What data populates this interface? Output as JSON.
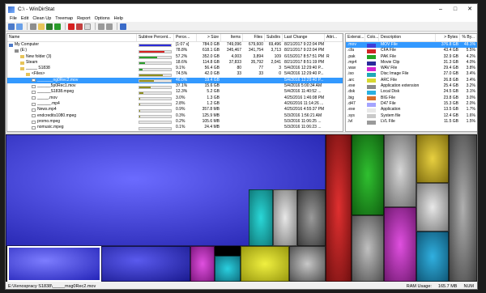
{
  "window": {
    "title": "C:\\ - WinDirStat"
  },
  "menu": [
    "File",
    "Edit",
    "Clean Up",
    "Treemap",
    "Report",
    "Options",
    "Help"
  ],
  "tree": {
    "headers": [
      "Name",
      "Subtree Percent...",
      "Perce...",
      "> Size",
      "Items",
      "Files",
      "Subdirs",
      "Last Change",
      "Attri..."
    ],
    "rows": [
      {
        "indent": 0,
        "icon": "computer-icon",
        "name": "My Computer",
        "pct": 1.0,
        "pcolor": "#2b2bd8",
        "perc": "[1:07 s]",
        "size": "784.0 GB",
        "items": "749,096",
        "files": "679,600",
        "subdirs": "69,496",
        "last": "8/21/2017  9:22:04 PM",
        "attr": ""
      },
      {
        "indent": 1,
        "icon": "drive-icon",
        "name": "(E:)",
        "pct": 0.788,
        "pcolor": "#d62020",
        "perc": "78.8%",
        "size": "618.1 GB",
        "items": "345,467",
        "files": "341,754",
        "subdirs": "3,713",
        "last": "8/21/2017  9:22:04 PM",
        "attr": ""
      },
      {
        "indent": 2,
        "icon": "folder-icon",
        "name": "New folder (3)",
        "pct": 0.572,
        "pcolor": "#2a9d2a",
        "perc": "57.2%",
        "size": "352.0 GB",
        "items": "4,003",
        "files": "3,894",
        "subdirs": "109",
        "last": "6/15/2017  8:57:51 PM",
        "attr": "R"
      },
      {
        "indent": 2,
        "icon": "folder-icon",
        "name": "Steam",
        "pct": 0.186,
        "pcolor": "#2a9d2a",
        "perc": "18.6%",
        "size": "114.8 GB",
        "items": "37,833",
        "files": "35,792",
        "subdirs": "2,041",
        "last": "8/21/2017  8:51:19 PM",
        "attr": ""
      },
      {
        "indent": 2,
        "icon": "folder-icon",
        "name": "_____ S1838",
        "pct": 0.091,
        "pcolor": "#2a9d2a",
        "perc": "9.1%",
        "size": "56.4 GB",
        "items": "80",
        "files": "77",
        "subdirs": "3",
        "last": "5/4/2016  12:29:40 P...",
        "attr": ""
      },
      {
        "indent": 3,
        "icon": "folder-icon",
        "name": "<Files>",
        "pct": 0.745,
        "pcolor": "#8f8f1e",
        "perc": "74.5%",
        "size": "42.0 GB",
        "items": "33",
        "files": "33",
        "subdirs": "0",
        "last": "5/4/2016  12:29:40 P...",
        "attr": ""
      },
      {
        "indent": 4,
        "icon": "file-icon",
        "name": "_______ng0Rec2.mov",
        "pct": 0.46,
        "pcolor": "#8f8f1e",
        "perc": "46.0%",
        "size": "19.4 GB",
        "items": "",
        "files": "",
        "subdirs": "",
        "last": "5/4/2016  12:29:40 P...",
        "attr": "",
        "sel": true
      },
      {
        "indent": 4,
        "icon": "file-icon",
        "name": "______5p0Rec1.mov",
        "pct": 0.371,
        "pcolor": "#8f8f1e",
        "perc": "37.1%",
        "size": "15.6 GB",
        "items": "",
        "files": "",
        "subdirs": "",
        "last": "5/4/2016  5:00:34 AM",
        "attr": ""
      },
      {
        "indent": 4,
        "icon": "file-icon",
        "name": "______S1838.mpeg",
        "pct": 0.123,
        "pcolor": "#8f8f1e",
        "perc": "12.3%",
        "size": "5.2 GB",
        "items": "",
        "files": "",
        "subdirs": "",
        "last": "5/4/2016  11:40:52 ...",
        "attr": ""
      },
      {
        "indent": 4,
        "icon": "file-icon",
        "name": "_____.mov",
        "pct": 0.03,
        "pcolor": "#8f8f1e",
        "perc": "3.0%",
        "size": "1.3 GB",
        "items": "",
        "files": "",
        "subdirs": "",
        "last": "4/25/2016  1:46:08 PM",
        "attr": ""
      },
      {
        "indent": 4,
        "icon": "file-icon",
        "name": "______.mp4",
        "pct": 0.028,
        "pcolor": "#8f8f1e",
        "perc": "2.8%",
        "size": "1.2 GB",
        "items": "",
        "files": "",
        "subdirs": "",
        "last": "4/26/2016  11:14:26 ...",
        "attr": ""
      },
      {
        "indent": 4,
        "icon": "file-icon",
        "name": "News.mp4",
        "pct": 0.009,
        "pcolor": "#8f8f1e",
        "perc": "0.9%",
        "size": "357.8 MB",
        "items": "",
        "files": "",
        "subdirs": "",
        "last": "4/25/2016  4:55:37 PM",
        "attr": ""
      },
      {
        "indent": 4,
        "icon": "file-icon",
        "name": "endcredits1080.mpeg",
        "pct": 0.003,
        "pcolor": "#8f8f1e",
        "perc": "0.3%",
        "size": "125.9 MB",
        "items": "",
        "files": "",
        "subdirs": "",
        "last": "5/3/2016  1:56:21 AM",
        "attr": ""
      },
      {
        "indent": 4,
        "icon": "file-icon",
        "name": "promo.mpeg",
        "pct": 0.002,
        "pcolor": "#8f8f1e",
        "perc": "0.2%",
        "size": "105.6 MB",
        "items": "",
        "files": "",
        "subdirs": "",
        "last": "5/3/2016  11:06:25 ...",
        "attr": ""
      },
      {
        "indent": 4,
        "icon": "file-icon",
        "name": "nomusic.mpeg",
        "pct": 0.001,
        "pcolor": "#8f8f1e",
        "perc": "0.1%",
        "size": "24.4 MB",
        "items": "",
        "files": "",
        "subdirs": "",
        "last": "5/3/2016  11:06:23 ...",
        "attr": ""
      }
    ]
  },
  "ext": {
    "headers": [
      "Extensi...",
      "Colo...",
      "Description",
      "> Bytes",
      "% By..."
    ],
    "rows": [
      {
        "ext": ".mov",
        "color": "#3e3ed8",
        "desc": "MOV File",
        "bytes": "376.8 GB",
        "pct": "48.1%",
        "sel": true
      },
      {
        "ext": ".cfa",
        "color": "#d22424",
        "desc": "CFA File",
        "bytes": "43.4 GB",
        "pct": "5.5%"
      },
      {
        "ext": ".pak",
        "color": "#24a424",
        "desc": "PAK File",
        "bytes": "32.9 GB",
        "pct": "4.2%"
      },
      {
        "ext": ".mp4",
        "color": "#2a2a9a",
        "desc": "Movie Clip",
        "bytes": "31.3 GB",
        "pct": "4.0%"
      },
      {
        "ext": ".wav",
        "color": "#d226d2",
        "desc": "WAV File",
        "bytes": "29.4 GB",
        "pct": "3.8%"
      },
      {
        "ext": ".iso",
        "color": "#1ea8b8",
        "desc": "Disc Image File",
        "bytes": "27.0 GB",
        "pct": "3.4%"
      },
      {
        "ext": ".arc",
        "color": "#d8d830",
        "desc": "ARC File",
        "bytes": "26.8 GB",
        "pct": "3.4%"
      },
      {
        "ext": ".exe",
        "color": "#8a8a8a",
        "desc": "Application extension",
        "bytes": "25.4 GB",
        "pct": "3.2%"
      },
      {
        "ext": ".dsk",
        "color": "#2ab0e0",
        "desc": "Local Disk",
        "bytes": "24.5 GB",
        "pct": "3.1%"
      },
      {
        "ext": ".big",
        "color": "#d86e2a",
        "desc": "BIG File",
        "bytes": "23.8 GB",
        "pct": "3.0%"
      },
      {
        "ext": ".d47",
        "color": "#a4a4ff",
        "desc": "D47 File",
        "bytes": "15.3 GB",
        "pct": "2.0%"
      },
      {
        "ext": ".exe",
        "color": "#e8e8e8",
        "desc": "Application",
        "bytes": "13.5 GB",
        "pct": "1.7%"
      },
      {
        "ext": ".sys",
        "color": "#c9c9c9",
        "desc": "System file",
        "bytes": "12.4 GB",
        "pct": "1.6%"
      },
      {
        "ext": ".lvl",
        "color": "#9a9a9a",
        "desc": "LVL File",
        "bytes": "11.5 GB",
        "pct": "1.5%"
      }
    ]
  },
  "status": {
    "path": "E:\\Xenospracy S1838\\_____msg0Rec2.mov",
    "ram_label": "RAM Usage:",
    "ram_value": "165.7 MB",
    "num": "NUM"
  }
}
